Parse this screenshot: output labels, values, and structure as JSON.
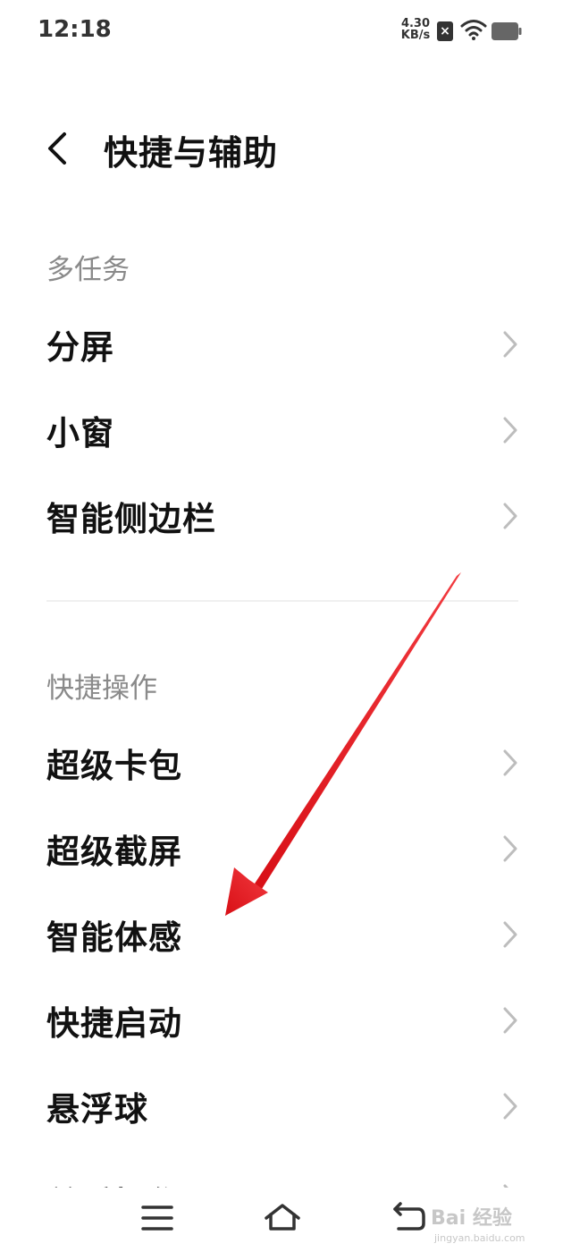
{
  "status_bar": {
    "time": "12:18",
    "net_speed_value": "4.30",
    "net_speed_unit": "KB/s",
    "icons": [
      "no-sim-icon",
      "wifi-icon",
      "battery-icon"
    ]
  },
  "header": {
    "back_icon": "chevron-left-icon",
    "title": "快捷与辅助"
  },
  "sections": [
    {
      "label": "多任务",
      "items": [
        "分屏",
        "小窗",
        "智能侧边栏"
      ]
    },
    {
      "label": "快捷操作",
      "items": [
        "超级卡包",
        "超级截屏",
        "智能体感",
        "快捷启动",
        "悬浮球",
        "单手操作"
      ]
    }
  ],
  "nav_bar": {
    "icons": [
      "menu-icon",
      "home-icon",
      "back-icon"
    ]
  },
  "annotation": {
    "arrow_color": "#e8141c"
  },
  "watermark": {
    "brand": "Bai 经验",
    "site": "jingyan.baidu.com"
  }
}
